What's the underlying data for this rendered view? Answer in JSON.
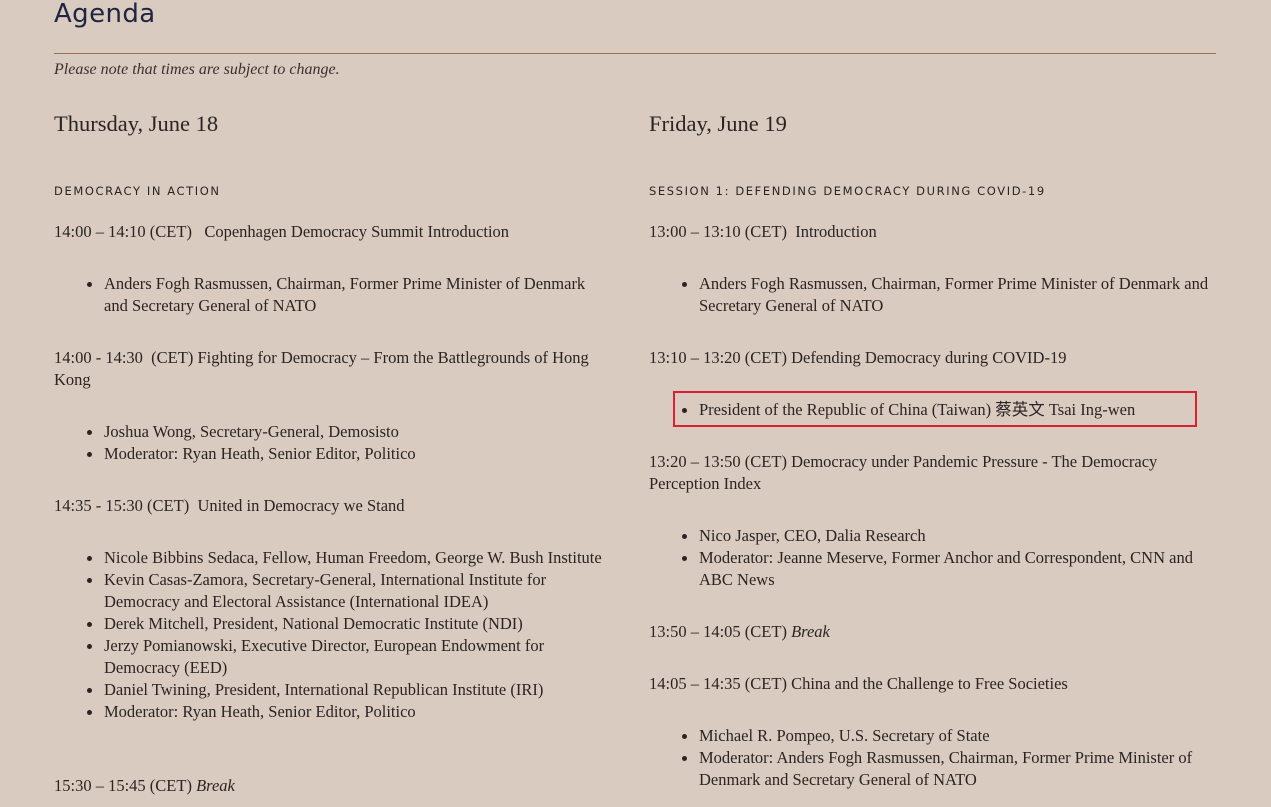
{
  "heading": "Agenda",
  "note": "Please note that times are subject to change.",
  "highlight_color": "#d92030",
  "days": [
    {
      "title": "Thursday, June 18",
      "session": "DEMOCRACY IN ACTION",
      "slots": [
        {
          "time": "14:00 – 14:10 (CET)",
          "title": "Copenhagen Democracy Summit Introduction",
          "speakers": [
            "Anders Fogh Rasmussen, Chairman, Former Prime Minister of Denmark and Secretary General of NATO"
          ]
        },
        {
          "time": "14:00 - 14:30",
          "title": "(CET)  Fighting for Democracy – From the Battlegrounds of Hong Kong",
          "speakers": [
            "Joshua Wong, Secretary-General, Demosisto",
            "Moderator: Ryan Heath, Senior Editor, Politico"
          ]
        },
        {
          "time": "14:35 - 15:30 (CET)",
          "title": "United in Democracy we Stand",
          "speakers": [
            "Nicole Bibbins Sedaca, Fellow, Human Freedom, George W. Bush Institute",
            "Kevin Casas-Zamora, Secretary-General, International Institute for Democracy and Electoral Assistance (International IDEA)",
            "Derek Mitchell, President, National Democratic Institute (NDI)",
            "Jerzy Pomianowski, Executive Director, European Endowment for Democracy (EED)",
            "Daniel Twining, President, International Republican Institute (IRI)",
            "Moderator: Ryan Heath, Senior Editor, Politico"
          ]
        },
        {
          "time": "15:30 – 15:45 (CET)",
          "title": "Break",
          "speakers": []
        }
      ]
    },
    {
      "title": "Friday, June 19",
      "session": "SESSION 1: DEFENDING DEMOCRACY DURING COVID-19",
      "slots": [
        {
          "time": "13:00 – 13:10 (CET)",
          "title": "Introduction",
          "speakers": [
            "Anders Fogh Rasmussen, Chairman, Former Prime Minister of Denmark and Secretary General of NATO"
          ]
        },
        {
          "time": "13:10 – 13:20 (CET)",
          "title": "Defending Democracy during COVID-19",
          "speakers": [
            "President of the Republic of China (Taiwan) 蔡英文 Tsai Ing-wen"
          ]
        },
        {
          "time": "13:20 – 13:50 (CET)",
          "title": "Democracy under Pandemic Pressure - The Democracy Perception Index",
          "speakers": [
            "Nico Jasper, CEO, Dalia Research",
            "Moderator: Jeanne Meserve, Former Anchor and Correspondent, CNN and ABC News"
          ]
        },
        {
          "time": "13:50 – 14:05 (CET)",
          "title": "Break",
          "speakers": []
        },
        {
          "time": "14:05 – 14:35 (CET)",
          "title": "China and the Challenge to Free Societies",
          "speakers": [
            "Michael R. Pompeo, U.S. Secretary of State",
            "Moderator: Anders Fogh Rasmussen, Chairman, Former Prime Minister of Denmark and Secretary General of NATO"
          ]
        }
      ]
    }
  ]
}
